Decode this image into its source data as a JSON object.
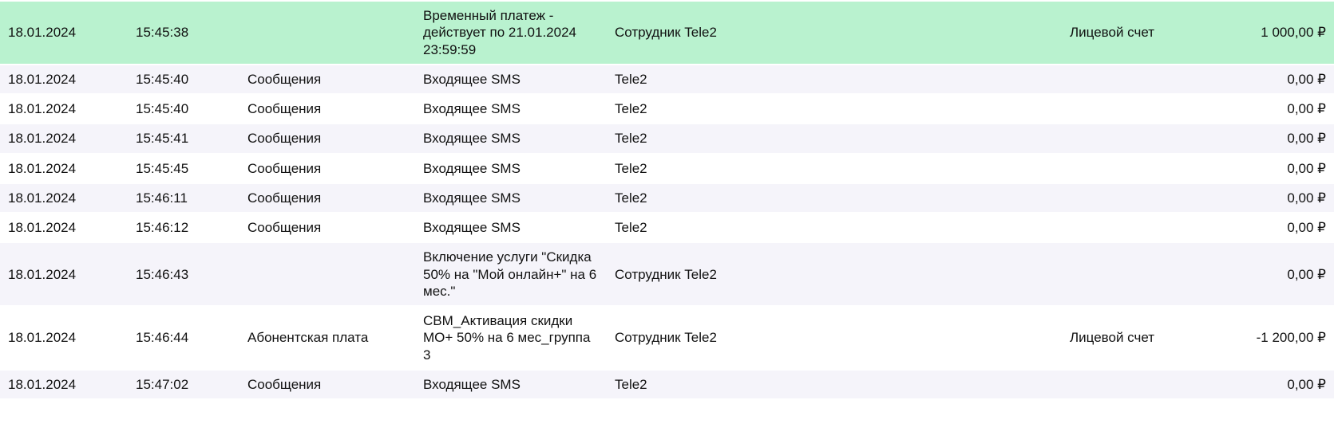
{
  "currency_symbol": "₽",
  "rows": [
    {
      "date": "18.01.2024",
      "time": "15:45:38",
      "category": "",
      "description": "Временный платеж - действует по 21.01.2024 23:59:59",
      "party": "Сотрудник Tele2",
      "extra1": "",
      "extra2": "",
      "account": "Лицевой счет",
      "amount": "1 000,00 ₽",
      "highlight": true
    },
    {
      "date": "18.01.2024",
      "time": "15:45:40",
      "category": "Сообщения",
      "description": "Входящее SMS",
      "party": "Tele2",
      "extra1": "",
      "extra2": "",
      "account": "",
      "amount": "0,00 ₽",
      "highlight": false
    },
    {
      "date": "18.01.2024",
      "time": "15:45:40",
      "category": "Сообщения",
      "description": "Входящее SMS",
      "party": "Tele2",
      "extra1": "",
      "extra2": "",
      "account": "",
      "amount": "0,00 ₽",
      "highlight": false
    },
    {
      "date": "18.01.2024",
      "time": "15:45:41",
      "category": "Сообщения",
      "description": "Входящее SMS",
      "party": "Tele2",
      "extra1": "",
      "extra2": "",
      "account": "",
      "amount": "0,00 ₽",
      "highlight": false
    },
    {
      "date": "18.01.2024",
      "time": "15:45:45",
      "category": "Сообщения",
      "description": "Входящее SMS",
      "party": "Tele2",
      "extra1": "",
      "extra2": "",
      "account": "",
      "amount": "0,00 ₽",
      "highlight": false
    },
    {
      "date": "18.01.2024",
      "time": "15:46:11",
      "category": "Сообщения",
      "description": "Входящее SMS",
      "party": "Tele2",
      "extra1": "",
      "extra2": "",
      "account": "",
      "amount": "0,00 ₽",
      "highlight": false
    },
    {
      "date": "18.01.2024",
      "time": "15:46:12",
      "category": "Сообщения",
      "description": "Входящее SMS",
      "party": "Tele2",
      "extra1": "",
      "extra2": "",
      "account": "",
      "amount": "0,00 ₽",
      "highlight": false
    },
    {
      "date": "18.01.2024",
      "time": "15:46:43",
      "category": "",
      "description": "Включение услуги \"Скидка 50% на \"Мой онлайн+\" на 6 мес.\"",
      "party": "Сотрудник Tele2",
      "extra1": "",
      "extra2": "",
      "account": "",
      "amount": "0,00 ₽",
      "highlight": false
    },
    {
      "date": "18.01.2024",
      "time": "15:46:44",
      "category": "Абонентская плата",
      "description": "CBM_Активация скидки МО+ 50% на 6 мес_группа 3",
      "party": "Сотрудник Tele2",
      "extra1": "",
      "extra2": "",
      "account": "Лицевой счет",
      "amount": "-1 200,00 ₽",
      "highlight": false
    },
    {
      "date": "18.01.2024",
      "time": "15:47:02",
      "category": "Сообщения",
      "description": "Входящее SMS",
      "party": "Tele2",
      "extra1": "",
      "extra2": "",
      "account": "",
      "amount": "0,00 ₽",
      "highlight": false
    }
  ]
}
